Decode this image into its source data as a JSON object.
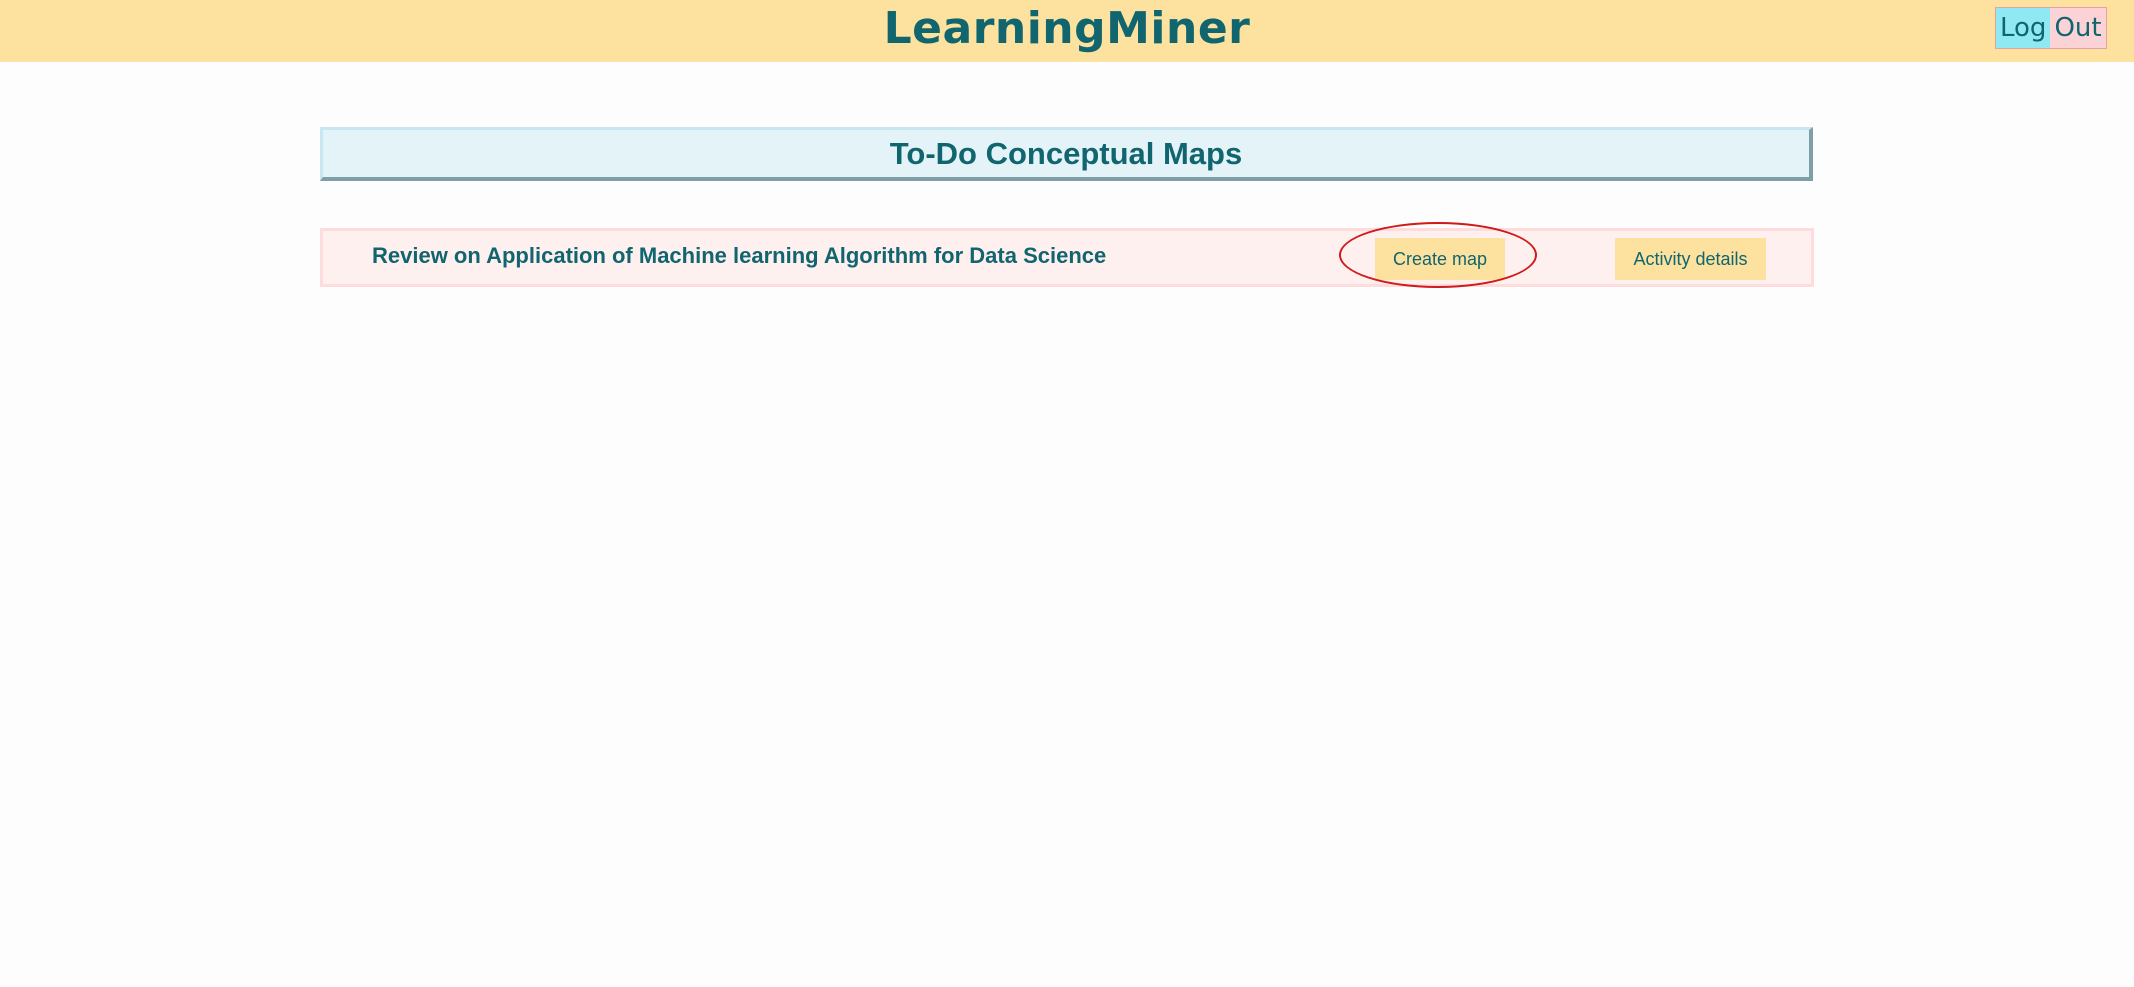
{
  "header": {
    "app_title": "LearningMiner",
    "logout": {
      "part1": "Log",
      "part2": "Out"
    }
  },
  "main": {
    "section_title": "To-Do Conceptual Maps",
    "maps": [
      {
        "title": "Review on Application of Machine learning Algorithm for Data Science",
        "create_label": "Create map",
        "details_label": "Activity details"
      }
    ]
  },
  "colors": {
    "header_bg": "#fde29f",
    "brand_text": "#11656f",
    "logout_log_bg": "#8fe9f2",
    "logout_out_bg": "#fbd3d6",
    "section_bg": "#e3f3f8",
    "row_bg": "#fff0f0",
    "button_bg": "#fde29f",
    "highlight": "#d11a1a"
  }
}
